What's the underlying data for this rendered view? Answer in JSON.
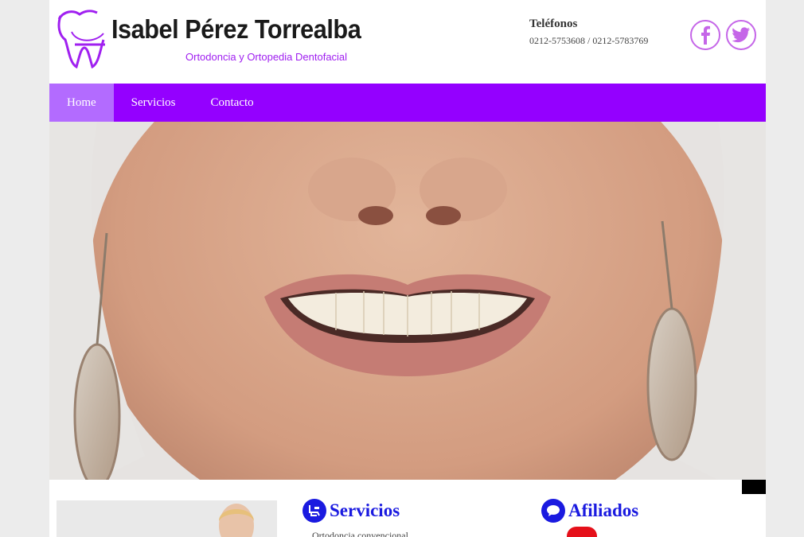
{
  "header": {
    "logo_name": "Isabel Pérez Torrealba",
    "logo_subtitle": "Ortodoncia y Ortopedia Dentofacial",
    "phones_title": "Teléfonos",
    "phones_numbers": "0212-5753608 / 0212-5783769",
    "social": [
      {
        "icon": "facebook-icon"
      },
      {
        "icon": "twitter-icon"
      }
    ]
  },
  "nav": {
    "items": [
      {
        "label": "Home",
        "active": true
      },
      {
        "label": "Servicios",
        "active": false
      },
      {
        "label": "Contacto",
        "active": false
      }
    ]
  },
  "sections": {
    "servicios": {
      "title": "Servicios",
      "icon": "dental-chair-icon",
      "text": "Ortodoncia convencional"
    },
    "afiliados": {
      "title": "Afiliados",
      "icon": "chat-bubble-icon"
    }
  },
  "colors": {
    "nav_bg": "#9400ff",
    "nav_active": "#b36bff",
    "accent": "#a020f0",
    "section_title": "#1a1ae0"
  }
}
